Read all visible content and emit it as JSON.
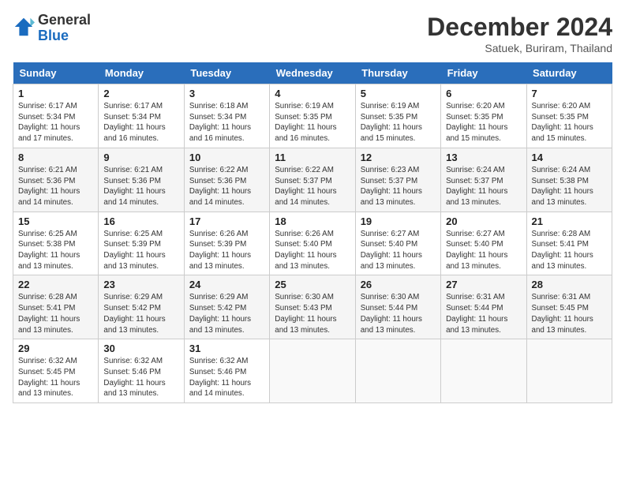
{
  "header": {
    "logo_general": "General",
    "logo_blue": "Blue",
    "month_year": "December 2024",
    "location": "Satuek, Buriram, Thailand"
  },
  "days_of_week": [
    "Sunday",
    "Monday",
    "Tuesday",
    "Wednesday",
    "Thursday",
    "Friday",
    "Saturday"
  ],
  "weeks": [
    [
      {
        "day": "1",
        "sunrise": "6:17 AM",
        "sunset": "5:34 PM",
        "daylight": "11 hours and 17 minutes."
      },
      {
        "day": "2",
        "sunrise": "6:17 AM",
        "sunset": "5:34 PM",
        "daylight": "11 hours and 16 minutes."
      },
      {
        "day": "3",
        "sunrise": "6:18 AM",
        "sunset": "5:34 PM",
        "daylight": "11 hours and 16 minutes."
      },
      {
        "day": "4",
        "sunrise": "6:19 AM",
        "sunset": "5:35 PM",
        "daylight": "11 hours and 16 minutes."
      },
      {
        "day": "5",
        "sunrise": "6:19 AM",
        "sunset": "5:35 PM",
        "daylight": "11 hours and 15 minutes."
      },
      {
        "day": "6",
        "sunrise": "6:20 AM",
        "sunset": "5:35 PM",
        "daylight": "11 hours and 15 minutes."
      },
      {
        "day": "7",
        "sunrise": "6:20 AM",
        "sunset": "5:35 PM",
        "daylight": "11 hours and 15 minutes."
      }
    ],
    [
      {
        "day": "8",
        "sunrise": "6:21 AM",
        "sunset": "5:36 PM",
        "daylight": "11 hours and 14 minutes."
      },
      {
        "day": "9",
        "sunrise": "6:21 AM",
        "sunset": "5:36 PM",
        "daylight": "11 hours and 14 minutes."
      },
      {
        "day": "10",
        "sunrise": "6:22 AM",
        "sunset": "5:36 PM",
        "daylight": "11 hours and 14 minutes."
      },
      {
        "day": "11",
        "sunrise": "6:22 AM",
        "sunset": "5:37 PM",
        "daylight": "11 hours and 14 minutes."
      },
      {
        "day": "12",
        "sunrise": "6:23 AM",
        "sunset": "5:37 PM",
        "daylight": "11 hours and 13 minutes."
      },
      {
        "day": "13",
        "sunrise": "6:24 AM",
        "sunset": "5:37 PM",
        "daylight": "11 hours and 13 minutes."
      },
      {
        "day": "14",
        "sunrise": "6:24 AM",
        "sunset": "5:38 PM",
        "daylight": "11 hours and 13 minutes."
      }
    ],
    [
      {
        "day": "15",
        "sunrise": "6:25 AM",
        "sunset": "5:38 PM",
        "daylight": "11 hours and 13 minutes."
      },
      {
        "day": "16",
        "sunrise": "6:25 AM",
        "sunset": "5:39 PM",
        "daylight": "11 hours and 13 minutes."
      },
      {
        "day": "17",
        "sunrise": "6:26 AM",
        "sunset": "5:39 PM",
        "daylight": "11 hours and 13 minutes."
      },
      {
        "day": "18",
        "sunrise": "6:26 AM",
        "sunset": "5:40 PM",
        "daylight": "11 hours and 13 minutes."
      },
      {
        "day": "19",
        "sunrise": "6:27 AM",
        "sunset": "5:40 PM",
        "daylight": "11 hours and 13 minutes."
      },
      {
        "day": "20",
        "sunrise": "6:27 AM",
        "sunset": "5:40 PM",
        "daylight": "11 hours and 13 minutes."
      },
      {
        "day": "21",
        "sunrise": "6:28 AM",
        "sunset": "5:41 PM",
        "daylight": "11 hours and 13 minutes."
      }
    ],
    [
      {
        "day": "22",
        "sunrise": "6:28 AM",
        "sunset": "5:41 PM",
        "daylight": "11 hours and 13 minutes."
      },
      {
        "day": "23",
        "sunrise": "6:29 AM",
        "sunset": "5:42 PM",
        "daylight": "11 hours and 13 minutes."
      },
      {
        "day": "24",
        "sunrise": "6:29 AM",
        "sunset": "5:42 PM",
        "daylight": "11 hours and 13 minutes."
      },
      {
        "day": "25",
        "sunrise": "6:30 AM",
        "sunset": "5:43 PM",
        "daylight": "11 hours and 13 minutes."
      },
      {
        "day": "26",
        "sunrise": "6:30 AM",
        "sunset": "5:44 PM",
        "daylight": "11 hours and 13 minutes."
      },
      {
        "day": "27",
        "sunrise": "6:31 AM",
        "sunset": "5:44 PM",
        "daylight": "11 hours and 13 minutes."
      },
      {
        "day": "28",
        "sunrise": "6:31 AM",
        "sunset": "5:45 PM",
        "daylight": "11 hours and 13 minutes."
      }
    ],
    [
      {
        "day": "29",
        "sunrise": "6:32 AM",
        "sunset": "5:45 PM",
        "daylight": "11 hours and 13 minutes."
      },
      {
        "day": "30",
        "sunrise": "6:32 AM",
        "sunset": "5:46 PM",
        "daylight": "11 hours and 13 minutes."
      },
      {
        "day": "31",
        "sunrise": "6:32 AM",
        "sunset": "5:46 PM",
        "daylight": "11 hours and 14 minutes."
      },
      null,
      null,
      null,
      null
    ]
  ]
}
